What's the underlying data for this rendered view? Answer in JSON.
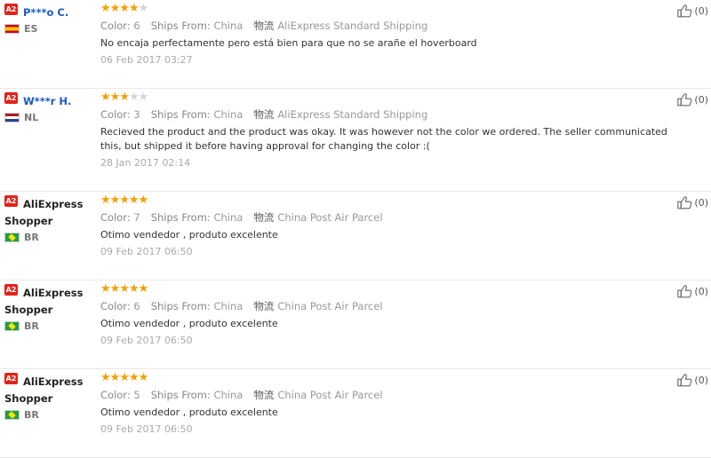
{
  "reviews": [
    {
      "badge": "A2",
      "name": "P***o C.",
      "country": "ES",
      "flag": "es",
      "link": true,
      "stars": 4,
      "color_label": "Color:",
      "color": "6",
      "ships_label": "Ships From:",
      "ships": "China",
      "ship_cn": "物流",
      "ship_method": "AliExpress Standard Shipping",
      "text": "No encaja perfectamente pero está bien para que no se arañe el hoverboard",
      "date": "06 Feb 2017 03:27",
      "helpful": "(0)"
    },
    {
      "badge": "A2",
      "name": "W***r H.",
      "country": "NL",
      "flag": "nl",
      "link": true,
      "stars": 3,
      "color_label": "Color:",
      "color": "3",
      "ships_label": "Ships From:",
      "ships": "China",
      "ship_cn": "物流",
      "ship_method": "AliExpress Standard Shipping",
      "text": "Recieved the product and the product was okay. It was however not the color we ordered. The seller communicated this, but shipped it before having approval for changing the color :(",
      "date": "28 Jan 2017 02:14",
      "helpful": "(0)"
    },
    {
      "badge": "A2",
      "name": "AliExpress Shopper",
      "country": "BR",
      "flag": "br",
      "link": false,
      "stars": 5,
      "color_label": "Color:",
      "color": "7",
      "ships_label": "Ships From:",
      "ships": "China",
      "ship_cn": "物流",
      "ship_method": "China Post Air Parcel",
      "text": "Otimo vendedor , produto excelente",
      "date": "09 Feb 2017 06:50",
      "helpful": "(0)"
    },
    {
      "badge": "A2",
      "name": "AliExpress Shopper",
      "country": "BR",
      "flag": "br",
      "link": false,
      "stars": 5,
      "color_label": "Color:",
      "color": "6",
      "ships_label": "Ships From:",
      "ships": "China",
      "ship_cn": "物流",
      "ship_method": "China Post Air Parcel",
      "text": "Otimo vendedor , produto excelente",
      "date": "09 Feb 2017 06:50",
      "helpful": "(0)"
    },
    {
      "badge": "A2",
      "name": "AliExpress Shopper",
      "country": "BR",
      "flag": "br",
      "link": false,
      "stars": 5,
      "color_label": "Color:",
      "color": "5",
      "ships_label": "Ships From:",
      "ships": "China",
      "ship_cn": "物流",
      "ship_method": "China Post Air Parcel",
      "text": "Otimo vendedor , produto excelente",
      "date": "09 Feb 2017 06:50",
      "helpful": "(0)"
    }
  ],
  "star_color": "#f49f00",
  "badge_color": "#e2231a",
  "icons": {
    "helpful": "thumbs-up-icon",
    "star": "star-icon"
  }
}
